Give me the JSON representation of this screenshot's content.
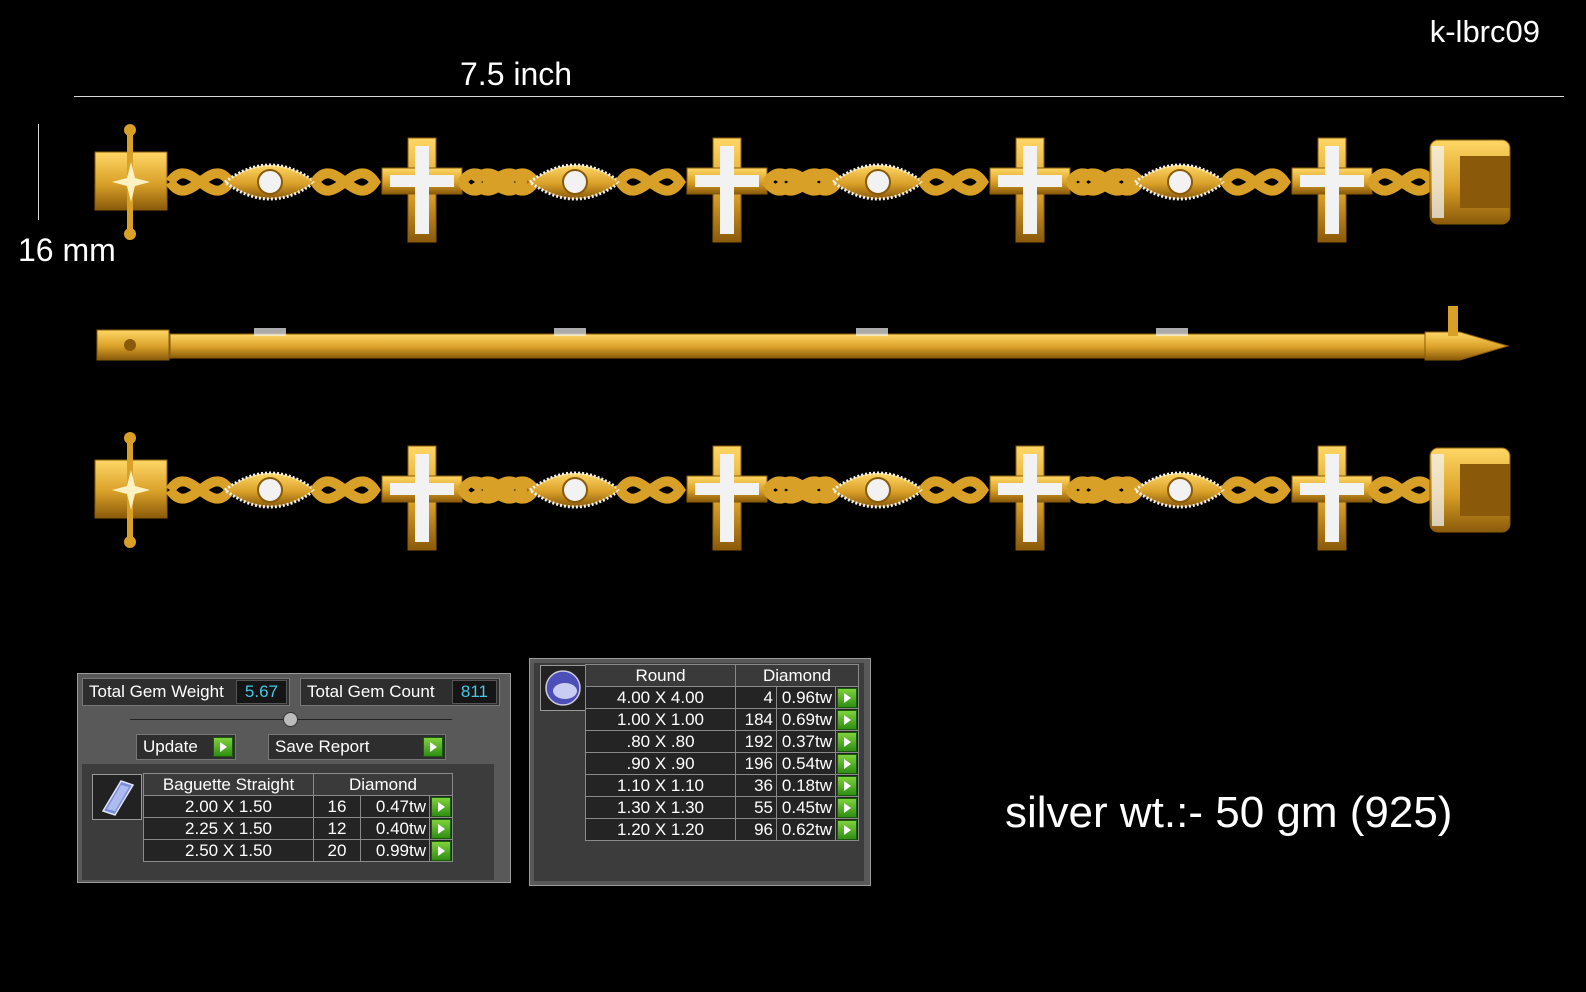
{
  "product_code": "k-lbrc09",
  "dimensions": {
    "width": "7.5 inch",
    "height": "16 mm"
  },
  "silver_weight": "silver wt.:- 50 gm (925)",
  "colors": {
    "gold": "#d9a028",
    "gold_dark": "#8a5a0a",
    "gold_light": "#ffd766",
    "diamond": "#f2f2f2",
    "value_text": "#49c6e5",
    "go_green": "#4cb82a"
  },
  "panel_left": {
    "total_gem_weight_label": "Total Gem Weight",
    "total_gem_weight": "5.67",
    "total_gem_count_label": "Total Gem Count",
    "total_gem_count": "811",
    "update_label": "Update",
    "save_report_label": "Save Report",
    "gem_icon": "baguette-gem-icon",
    "table": {
      "header_shape": "Baguette Straight",
      "header_material": "Diamond",
      "rows": [
        {
          "size": "2.00 X 1.50",
          "count": "16",
          "weight": "0.47tw"
        },
        {
          "size": "2.25 X 1.50",
          "count": "12",
          "weight": "0.40tw"
        },
        {
          "size": "2.50 X 1.50",
          "count": "20",
          "weight": "0.99tw"
        }
      ]
    }
  },
  "panel_right": {
    "gem_icon": "round-gem-icon",
    "table": {
      "header_shape": "Round",
      "header_material": "Diamond",
      "rows": [
        {
          "size": "4.00 X 4.00",
          "count": "4",
          "weight": "0.96tw"
        },
        {
          "size": "1.00 X 1.00",
          "count": "184",
          "weight": "0.69tw"
        },
        {
          "size": ".80 X .80",
          "count": "192",
          "weight": "0.37tw"
        },
        {
          "size": ".90 X .90",
          "count": "196",
          "weight": "0.54tw"
        },
        {
          "size": "1.10 X 1.10",
          "count": "36",
          "weight": "0.18tw"
        },
        {
          "size": "1.30 X 1.30",
          "count": "55",
          "weight": "0.45tw"
        },
        {
          "size": "1.20 X 1.20",
          "count": "96",
          "weight": "0.62tw"
        }
      ]
    }
  }
}
